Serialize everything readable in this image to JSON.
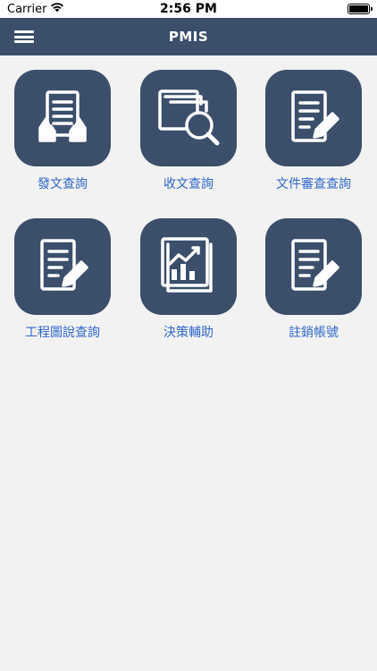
{
  "status_bar": {
    "carrier": "Carrier",
    "time": "2:56 PM"
  },
  "nav": {
    "title": "PMIS",
    "menu_icon": "hamburger-icon"
  },
  "colors": {
    "nav_bg": "#3b4f6b",
    "tile_bg": "#3b4f6b",
    "label": "#2f67c9",
    "page_bg": "#f2f2f2"
  },
  "tiles": [
    {
      "label": "發文查詢",
      "icon": "document-hands-icon"
    },
    {
      "label": "收文查詢",
      "icon": "document-search-icon"
    },
    {
      "label": "文件審查查詢",
      "icon": "document-edit-icon"
    },
    {
      "label": "工程圖說查詢",
      "icon": "document-edit-icon"
    },
    {
      "label": "決策輔助",
      "icon": "chart-report-icon"
    },
    {
      "label": "註銷帳號",
      "icon": "document-edit-icon"
    }
  ]
}
